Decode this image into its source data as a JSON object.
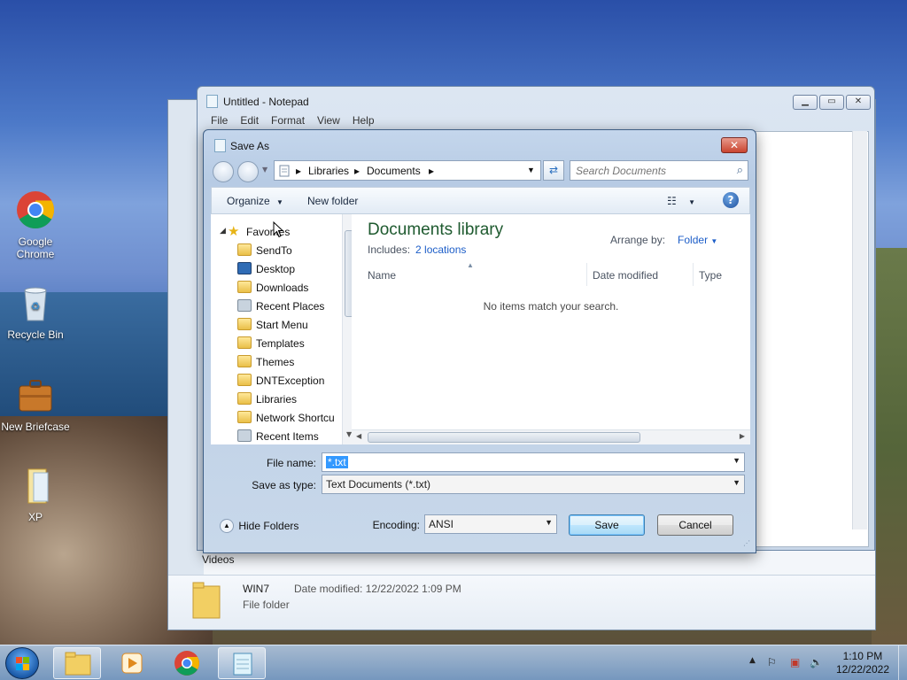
{
  "desktop": {
    "icons": [
      {
        "label": "Google Chrome"
      },
      {
        "label": "Recycle Bin"
      },
      {
        "label": "New Briefcase"
      },
      {
        "label": "XP"
      }
    ]
  },
  "explorer_bg": {
    "tree_item": "Videos",
    "details": {
      "name": "WIN7",
      "modified_label": "Date modified:",
      "modified_value": "12/22/2022 1:09 PM",
      "type": "File folder"
    }
  },
  "notepad": {
    "title": "Untitled - Notepad",
    "menu": [
      "File",
      "Edit",
      "Format",
      "View",
      "Help"
    ]
  },
  "dialog": {
    "title": "Save As",
    "breadcrumb": [
      "Libraries",
      "Documents"
    ],
    "search_placeholder": "Search Documents",
    "toolbar": {
      "organize": "Organize",
      "new_folder": "New folder"
    },
    "nav_items": [
      {
        "label": "Favorites",
        "icon": "star-icon"
      },
      {
        "label": "SendTo",
        "icon": "folder-icon"
      },
      {
        "label": "Desktop",
        "icon": "desktop-icon"
      },
      {
        "label": "Downloads",
        "icon": "downloads-folder-icon"
      },
      {
        "label": "Recent Places",
        "icon": "recent-places-icon"
      },
      {
        "label": "Start Menu",
        "icon": "folder-icon"
      },
      {
        "label": "Templates",
        "icon": "folder-icon"
      },
      {
        "label": "Themes",
        "icon": "folder-icon"
      },
      {
        "label": "DNTException",
        "icon": "folder-icon"
      },
      {
        "label": "Libraries",
        "icon": "folder-icon"
      },
      {
        "label": "Network Shortcu",
        "icon": "folder-icon"
      },
      {
        "label": "Recent Items",
        "icon": "recent-items-icon"
      }
    ],
    "library": {
      "title": "Documents library",
      "includes_label": "Includes:",
      "includes_link": "2 locations",
      "arrange_label": "Arrange by:",
      "arrange_value": "Folder"
    },
    "columns": [
      "Name",
      "Date modified",
      "Type"
    ],
    "empty_message": "No items match your search.",
    "file_name_label": "File name:",
    "file_name_value": "*.txt",
    "save_type_label": "Save as type:",
    "save_type_value": "Text Documents (*.txt)",
    "hide_folders": "Hide Folders",
    "encoding_label": "Encoding:",
    "encoding_value": "ANSI",
    "save_button": "Save",
    "cancel_button": "Cancel"
  },
  "taskbar": {
    "time": "1:10 PM",
    "date": "12/22/2022"
  }
}
